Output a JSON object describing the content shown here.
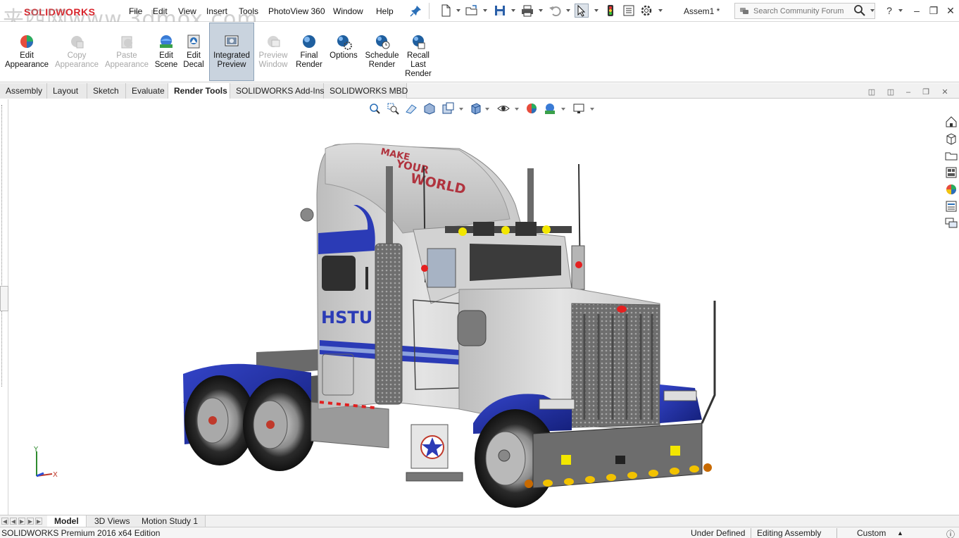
{
  "app": {
    "brand": "SOLIDWORKS",
    "document_title": "Assem1 *",
    "watermark": "夹西网www.3dmox.com"
  },
  "menu": {
    "items": [
      "File",
      "Edit",
      "View",
      "Insert",
      "Tools",
      "PhotoView 360",
      "Window",
      "Help"
    ]
  },
  "toolbar": {
    "icons": [
      "new-document-icon",
      "open-folder-icon",
      "save-icon",
      "print-icon",
      "undo-icon",
      "select-arrow-icon",
      "rebuild-traffic-light-icon",
      "file-properties-icon",
      "options-gear-icon"
    ]
  },
  "search": {
    "placeholder": "Search Community Forum"
  },
  "command_manager": {
    "buttons": [
      {
        "label_1": "Edit",
        "label_2": "Appearance",
        "state": "enabled"
      },
      {
        "label_1": "Copy",
        "label_2": "Appearance",
        "state": "disabled"
      },
      {
        "label_1": "Paste",
        "label_2": "Appearance",
        "state": "disabled"
      },
      {
        "label_1": "Edit",
        "label_2": "Scene",
        "state": "enabled"
      },
      {
        "label_1": "Edit",
        "label_2": "Decal",
        "state": "enabled"
      },
      {
        "label_1": "Integrated",
        "label_2": "Preview",
        "state": "active"
      },
      {
        "label_1": "Preview",
        "label_2": "Window",
        "state": "disabled"
      },
      {
        "label_1": "Final",
        "label_2": "Render",
        "state": "enabled"
      },
      {
        "label_1": "Options",
        "label_2": "",
        "state": "enabled"
      },
      {
        "label_1": "Schedule",
        "label_2": "Render",
        "state": "enabled"
      },
      {
        "label_1": "Recall",
        "label_2": "Last",
        "label_3": "Render",
        "state": "enabled"
      }
    ]
  },
  "tabs": [
    {
      "label": "Assembly",
      "active": false
    },
    {
      "label": "Layout",
      "active": false
    },
    {
      "label": "Sketch",
      "active": false
    },
    {
      "label": "Evaluate",
      "active": false
    },
    {
      "label": "Render Tools",
      "active": true
    },
    {
      "label": "SOLIDWORKS Add-Ins",
      "active": false
    },
    {
      "label": "SOLIDWORKS MBD",
      "active": false
    }
  ],
  "model": {
    "cab_text_line1": "MAKE",
    "cab_text_line2": "YOUR",
    "cab_text_line3": "WORLD",
    "door_text": "HSTU"
  },
  "triad": {
    "y_label": "Y",
    "x_label": "X"
  },
  "bottom_tabs": [
    {
      "label": "Model",
      "active": true
    },
    {
      "label": "3D Views",
      "active": false
    },
    {
      "label": "Motion Study 1",
      "active": false
    }
  ],
  "status": {
    "edition": "SOLIDWORKS Premium 2016 x64 Edition",
    "definition": "Under Defined",
    "mode": "Editing Assembly",
    "units": "Custom"
  },
  "colors": {
    "accent_red": "#d8232a",
    "truck_blue": "#2b3bb6",
    "truck_body": "#d6d6d6"
  }
}
